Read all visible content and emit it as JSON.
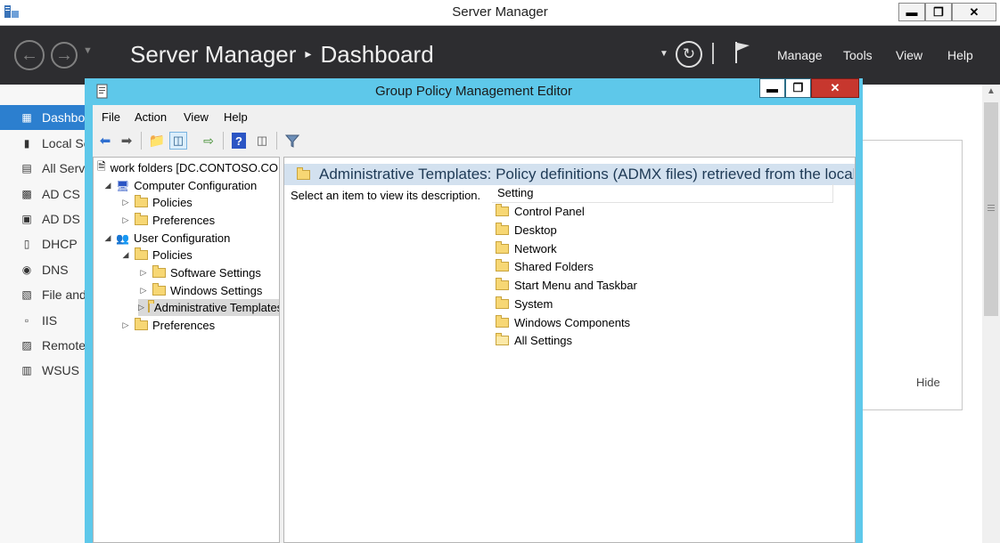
{
  "server_manager": {
    "window_title": "Server Manager",
    "caption_buttons": {
      "minimize": "▬",
      "restore": "❐",
      "close": "✕"
    },
    "breadcrumb": {
      "root": "Server Manager",
      "separator": "▸",
      "current": "Dashboard"
    },
    "header_menu": [
      "Manage",
      "Tools",
      "View",
      "Help"
    ],
    "sidebar": [
      {
        "label": "Dashboard",
        "icon": "dashboard-icon",
        "selected": true
      },
      {
        "label": "Local Server",
        "icon": "server-icon"
      },
      {
        "label": "All Servers",
        "icon": "servers-icon"
      },
      {
        "label": "AD CS",
        "icon": "certificate-icon"
      },
      {
        "label": "AD DS",
        "icon": "directory-icon"
      },
      {
        "label": "DHCP",
        "icon": "dhcp-icon"
      },
      {
        "label": "DNS",
        "icon": "dns-icon"
      },
      {
        "label": "File and Storage Services",
        "icon": "file-storage-icon"
      },
      {
        "label": "IIS",
        "icon": "iis-icon"
      },
      {
        "label": "Remote Access",
        "icon": "remote-icon"
      },
      {
        "label": "WSUS",
        "icon": "wsus-icon"
      }
    ],
    "panel_hide_label": "Hide",
    "colors": {
      "header_bg": "#2d2d30",
      "sidebar_selected": "#2c7fcf"
    }
  },
  "gpme": {
    "window_title": "Group Policy Management Editor",
    "caption_buttons": {
      "minimize": "▬",
      "restore": "❐",
      "close": "✕"
    },
    "menu": [
      "File",
      "Action",
      "View",
      "Help"
    ],
    "tree": {
      "root": "work folders [DC.CONTOSO.COM]",
      "computer_config": "Computer Configuration",
      "cc_policies": "Policies",
      "cc_preferences": "Preferences",
      "user_config": "User Configuration",
      "uc_policies": "Policies",
      "software_settings": "Software Settings",
      "windows_settings": "Windows Settings",
      "admin_templates": "Administrative Templates",
      "uc_preferences": "Preferences"
    },
    "details": {
      "header": "Administrative Templates: Policy definitions (ADMX files) retrieved from the local computer",
      "description": "Select an item to view its description.",
      "column_setting": "Setting",
      "items": [
        "Control Panel",
        "Desktop",
        "Network",
        "Shared Folders",
        "Start Menu and Taskbar",
        "System",
        "Windows Components",
        "All Settings"
      ]
    },
    "colors": {
      "frame": "#5ec8ea",
      "close_button": "#c7372e",
      "header_bar": "#d3e1ef"
    }
  }
}
